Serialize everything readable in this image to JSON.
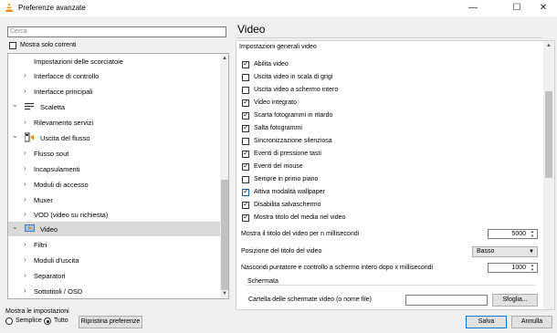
{
  "window": {
    "title": "Preferenze avanzate",
    "minimize": "—",
    "maximize": "☐",
    "close": "✕"
  },
  "search": {
    "placeholder": "Cerca"
  },
  "only_current": {
    "label": "Mostra solo correnti",
    "checked": false
  },
  "tree": {
    "items": [
      {
        "label": "Impostazioni delle scorciatoie",
        "indent": 1,
        "chevron": ""
      },
      {
        "label": "Interfacce di controllo",
        "indent": 1,
        "chevron": "›"
      },
      {
        "label": "Interfacce principali",
        "indent": 1,
        "chevron": "›"
      },
      {
        "label": "Scaletta",
        "indent": 0,
        "chevron": "⌄",
        "icon": "playlist-icon"
      },
      {
        "label": "Rilevamento servizi",
        "indent": 1,
        "chevron": "›"
      },
      {
        "label": "Uscita del flusso",
        "indent": 0,
        "chevron": "⌄",
        "icon": "stream-output-icon"
      },
      {
        "label": "Flusso sout",
        "indent": 1,
        "chevron": "›"
      },
      {
        "label": "Incapsulamenti",
        "indent": 1,
        "chevron": "›"
      },
      {
        "label": "Moduli di accesso",
        "indent": 1,
        "chevron": "›"
      },
      {
        "label": "Muxer",
        "indent": 1,
        "chevron": "›"
      },
      {
        "label": "VOD (video su richiesta)",
        "indent": 1,
        "chevron": "›"
      },
      {
        "label": "Video",
        "indent": 0,
        "chevron": "⌄",
        "icon": "video-icon",
        "selected": true
      },
      {
        "label": "Filtri",
        "indent": 1,
        "chevron": "›"
      },
      {
        "label": "Moduli d'uscita",
        "indent": 1,
        "chevron": "›"
      },
      {
        "label": "Separatori",
        "indent": 1,
        "chevron": "›"
      },
      {
        "label": "Sottotitoli / OSD",
        "indent": 1,
        "chevron": "›"
      }
    ],
    "scroll_up": "▲",
    "scroll_down": "▼"
  },
  "show_settings": {
    "label": "Mostra le impostazioni",
    "simple": "Semplice",
    "all": "Tutto",
    "selected": "all"
  },
  "buttons": {
    "reset": "Ripristina preferenze",
    "save": "Salva",
    "cancel": "Annulla",
    "browse": "Sfoglia..."
  },
  "panel": {
    "title": "Video",
    "section": "Impostazioni generali video",
    "options": [
      {
        "label": "Abilita video",
        "checked": true
      },
      {
        "label": "Uscita video in scala di grigi",
        "checked": false
      },
      {
        "label": "Uscita video a schermo intero",
        "checked": false
      },
      {
        "label": "Video integrato",
        "checked": true
      },
      {
        "label": "Scarta fotogrammi in ritardo",
        "checked": true
      },
      {
        "label": "Salta fotogrammi",
        "checked": true
      },
      {
        "label": "Sincronizzazione silenziosa",
        "checked": false
      },
      {
        "label": "Eventi di pressione tasti",
        "checked": true
      },
      {
        "label": "Eventi del mouse",
        "checked": true
      },
      {
        "label": "Sempre in primo piano",
        "checked": false
      },
      {
        "label": "Attiva modalità wallpaper",
        "checked": true,
        "focused": true
      },
      {
        "label": "Disabilita salvaschermo",
        "checked": true
      },
      {
        "label": "Mostra titolo del media nel video",
        "checked": true
      }
    ],
    "title_ms": {
      "label": "Mostra il titolo del video per n millisecondi",
      "value": "5000"
    },
    "title_position": {
      "label": "Posizione del titolo del video",
      "value": "Basso"
    },
    "hide_cursor": {
      "label": "Nascondi puntatore e controllo a schermo intero dopo x millisecondi",
      "value": "1000"
    },
    "screenshot": {
      "group_title": "Schermata",
      "folder_label": "Cartella delle schermate video (o nome file)",
      "folder_value": ""
    }
  },
  "colors": {
    "selection": "#d9d9d9",
    "focus_border": "#0078d7",
    "window_bg": "#f0f0f0"
  }
}
